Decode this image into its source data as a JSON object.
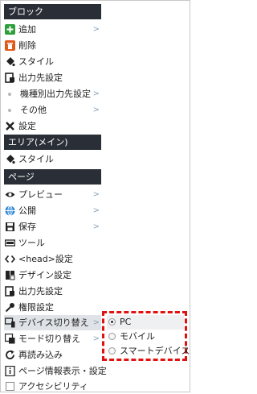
{
  "sections": {
    "block": "ブロック",
    "area_main": "エリア(メイン)",
    "page": "ページ"
  },
  "block_items": {
    "add": "追加",
    "delete": "削除",
    "style": "スタイル",
    "output": "出力先設定",
    "device_output": "機種別出力先設定",
    "other": "その他",
    "settings": "設定"
  },
  "area_items": {
    "style": "スタイル"
  },
  "page_items": {
    "preview": "プレビュー",
    "publish": "公開",
    "save": "保存",
    "tools": "ツール",
    "head_settings": "<head>設定",
    "design_settings": "デザイン設定",
    "output": "出力先設定",
    "permissions": "権限設定",
    "device_switch": "デバイス切り替え",
    "mode_switch": "モード切り替え",
    "reload": "再読み込み",
    "page_info": "ページ情報表示・設定",
    "accessibility": "アクセシビリティ"
  },
  "arrow": ">",
  "device_submenu": {
    "options": [
      "PC",
      "モバイル",
      "スマートデバイス"
    ],
    "selected": "PC"
  },
  "colors": {
    "header_bg": "#2a2f37",
    "highlight_border": "#e11111",
    "add_icon": "#2e9e3a",
    "delete_icon": "#e05a1c",
    "publish_icon": "#2a86d6"
  }
}
